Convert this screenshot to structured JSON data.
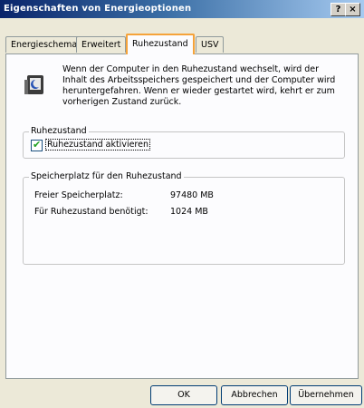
{
  "window": {
    "title": "Eigenschaften von Energieoptionen",
    "help_label": "?",
    "close_label": "×"
  },
  "tabs": [
    {
      "label": "Energieschemas",
      "active": false
    },
    {
      "label": "Erweitert",
      "active": false
    },
    {
      "label": "Ruhezustand",
      "active": true
    },
    {
      "label": "USV",
      "active": false
    }
  ],
  "panel": {
    "info_icon": "hibernate-computer-icon",
    "info_text": "Wenn der Computer in den Ruhezustand wechselt, wird der Inhalt des Arbeitsspeichers gespeichert und der Computer wird heruntergefahren. Wenn er wieder gestartet wird, kehrt er zum vorherigen Zustand zurück.",
    "hibernate_group": {
      "legend": "Ruhezustand",
      "checkbox_label": "Ruhezustand aktivieren",
      "checked": true
    },
    "storage_group": {
      "legend": "Speicherplatz für den Ruhezustand",
      "free_label": "Freier Speicherplatz:",
      "free_value": "97480 MB",
      "required_label": "Für Ruhezustand benötigt:",
      "required_value": "1024 MB"
    }
  },
  "buttons": {
    "ok": "OK",
    "cancel": "Abbrechen",
    "apply": "Übernehmen"
  }
}
